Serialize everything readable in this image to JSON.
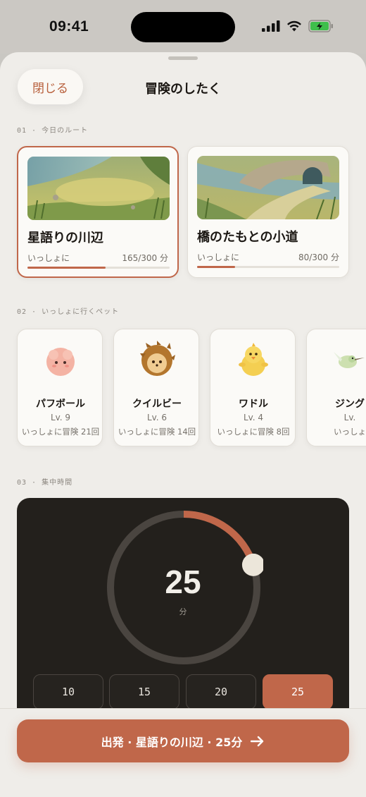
{
  "status_bar": {
    "time": "09:41"
  },
  "header": {
    "close_label": "閉じる",
    "title": "冒険のしたく"
  },
  "sections": {
    "route_label": "01 · 今日のルート",
    "pet_label": "02 · いっしょに行くペット",
    "focus_label": "03 · 集中時間"
  },
  "routes": [
    {
      "name": "星語りの川辺",
      "companion": "いっしょに",
      "progress": "165/300 分",
      "progress_fraction": 0.55,
      "selected": true
    },
    {
      "name": "橋のたもとの小道",
      "companion": "いっしょに",
      "progress": "80/300 分",
      "progress_fraction": 0.267,
      "selected": false
    }
  ],
  "pets": [
    {
      "name": "パフボール",
      "level": "Lv. 9",
      "adventures": "いっしょに冒険 21回",
      "icon": "pink-puffball-icon"
    },
    {
      "name": "クイルビー",
      "level": "Lv. 6",
      "adventures": "いっしょに冒険 14回",
      "icon": "hedgehog-icon"
    },
    {
      "name": "ワドル",
      "level": "Lv. 4",
      "adventures": "いっしょに冒険 8回",
      "icon": "yellow-chick-icon"
    },
    {
      "name": "ジング",
      "level": "Lv.",
      "adventures": "いっしょ",
      "icon": "hummingbird-icon"
    }
  ],
  "timer": {
    "value": "25",
    "unit": "分",
    "dial_fraction": 0.2,
    "presets": [
      "10",
      "15",
      "20",
      "25"
    ],
    "active_preset": "25"
  },
  "start_button": {
    "label": "出発 · 星語りの川辺 · 25分"
  },
  "colors": {
    "accent": "#c0674a",
    "panel": "#23201c",
    "background": "#efede9"
  }
}
